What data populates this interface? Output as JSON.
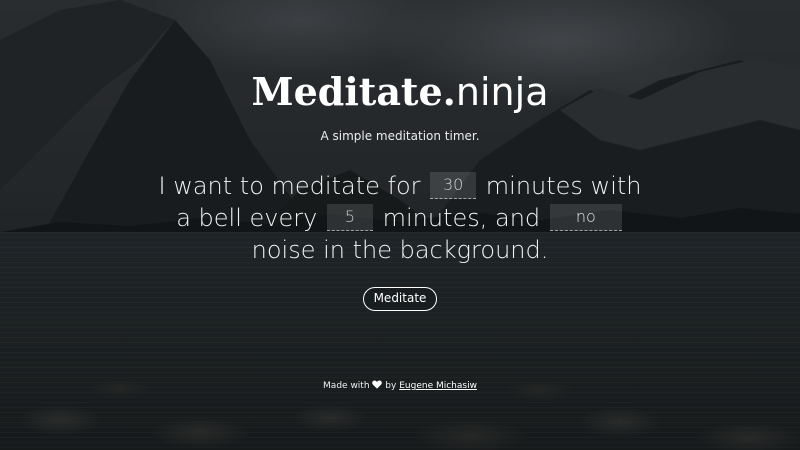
{
  "brand": {
    "bold": "Meditate.",
    "light": "ninja"
  },
  "tagline": "A simple meditation timer.",
  "sentence": {
    "part1": "I want to meditate for",
    "minutes_value": "30",
    "part2": "minutes with",
    "part3": "a bell every",
    "bell_value": "5",
    "part4": "minutes, and",
    "noise_value": "no",
    "part5": "noise in the background."
  },
  "button": {
    "label": "Meditate"
  },
  "footer": {
    "prefix": "Made with",
    "icon": "heart-icon",
    "by": "by",
    "author": "Eugene Michasiw"
  },
  "colors": {
    "text": "#ffffff",
    "field_bg": "rgba(255,255,255,0.12)"
  }
}
